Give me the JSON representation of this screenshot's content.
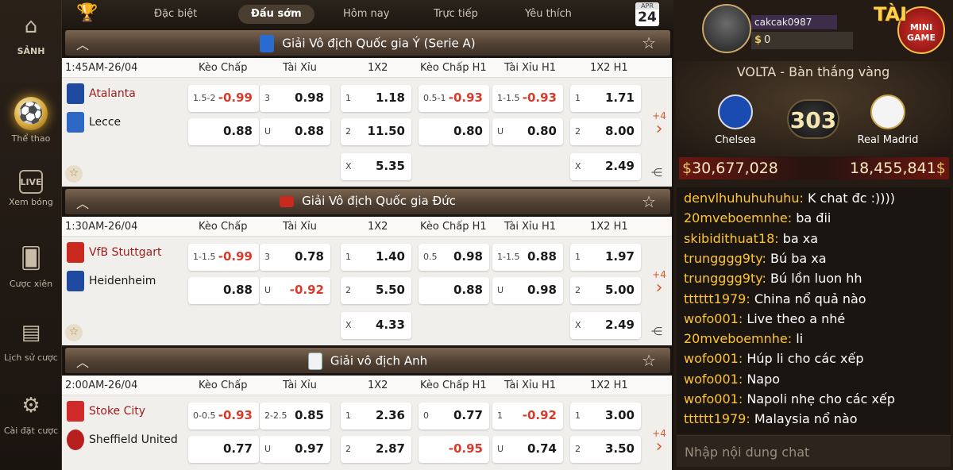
{
  "nav": [
    {
      "label": "SẢNH",
      "icon": "home-icon"
    },
    {
      "label": "Thể thao",
      "icon": "soccer-ball-icon"
    },
    {
      "label": "Xem bóng",
      "icon": "tv-live-icon"
    },
    {
      "label": "Cược xiên",
      "icon": "parlay-icon"
    },
    {
      "label": "Lịch sử cược",
      "icon": "history-icon"
    },
    {
      "label": "Cài đặt cược",
      "icon": "gear-icon"
    }
  ],
  "tabs": [
    "Đặc biệt",
    "Đấu sớm",
    "Hôm nay",
    "Trực tiếp",
    "Yêu thích"
  ],
  "active_tab": "Đấu sớm",
  "date": {
    "month": "APR",
    "day": "24"
  },
  "columns": [
    "Kèo Chấp",
    "Tài Xỉu",
    "1X2",
    "Kèo Chấp H1",
    "Tài Xỉu H1",
    "1X2 H1"
  ],
  "leagues": [
    {
      "name": "Giải Vô địch Quốc gia Ý (Serie A)",
      "time": "1:45AM-26/04",
      "home": "Atalanta",
      "away": "Lecce",
      "more": "+4",
      "row1": [
        [
          "1.5-2",
          "-0.99"
        ],
        [
          "3",
          "0.98"
        ],
        [
          "1",
          "1.18"
        ],
        [
          "0.5-1",
          "-0.93"
        ],
        [
          "1-1.5",
          "-0.93"
        ],
        [
          "1",
          "1.71"
        ]
      ],
      "row2": [
        [
          "",
          "0.88"
        ],
        [
          "U",
          "0.88"
        ],
        [
          "2",
          "11.50"
        ],
        [
          "",
          "0.80"
        ],
        [
          "U",
          "0.80"
        ],
        [
          "2",
          "8.00"
        ]
      ],
      "draw": [
        [
          "X",
          "5.35"
        ],
        [
          "X",
          "2.49"
        ]
      ]
    },
    {
      "name": "Giải Vô địch Quốc gia Đức",
      "time": "1:30AM-26/04",
      "home": "VfB Stuttgart",
      "away": "Heidenheim",
      "more": "+4",
      "row1": [
        [
          "1-1.5",
          "-0.99"
        ],
        [
          "3",
          "0.78"
        ],
        [
          "1",
          "1.40"
        ],
        [
          "0.5",
          "0.98"
        ],
        [
          "1-1.5",
          "0.88"
        ],
        [
          "1",
          "1.97"
        ]
      ],
      "row2": [
        [
          "",
          "0.88"
        ],
        [
          "U",
          "-0.92"
        ],
        [
          "2",
          "5.50"
        ],
        [
          "",
          "0.88"
        ],
        [
          "U",
          "0.98"
        ],
        [
          "2",
          "5.00"
        ]
      ],
      "draw": [
        [
          "X",
          "4.33"
        ],
        [
          "X",
          "2.49"
        ]
      ]
    },
    {
      "name": "Giải vô địch Anh",
      "time": "2:00AM-26/04",
      "home": "Stoke City",
      "away": "Sheffield United",
      "more": "+4",
      "row1": [
        [
          "0-0.5",
          "-0.93"
        ],
        [
          "2-2.5",
          "0.85"
        ],
        [
          "1",
          "2.36"
        ],
        [
          "0",
          "0.77"
        ],
        [
          "1",
          "-0.92"
        ],
        [
          "1",
          "3.00"
        ]
      ],
      "row2": [
        [
          "",
          "0.77"
        ],
        [
          "U",
          "0.97"
        ],
        [
          "2",
          "2.87"
        ],
        [
          "",
          "-0.95"
        ],
        [
          "U",
          "0.74"
        ],
        [
          "2",
          "3.50"
        ]
      ],
      "draw": []
    }
  ],
  "user": {
    "name": "cakcak0987",
    "balance": "0",
    "currency_symbol": "$"
  },
  "minigame": {
    "tai": "TÀI",
    "label": "MINI GAME"
  },
  "volta": {
    "title": "VOLTA - Bàn thắng vàng",
    "home": "Chelsea",
    "away": "Real Madrid",
    "score": "303",
    "home_pot": "30,677,028",
    "away_pot": "18,455,841"
  },
  "chat": [
    {
      "user": "denvlhuhuhuhuhu:",
      "text": " K chat đc :))))"
    },
    {
      "user": "20mveboemnhe:",
      "text": " ba đii"
    },
    {
      "user": "skibidithuat18:",
      "text": " ba xa"
    },
    {
      "user": "trungggg9ty:",
      "text": " Bú ba xa"
    },
    {
      "user": "trungggg9ty:",
      "text": " Bú lồn luon hh"
    },
    {
      "user": "tttttt1979:",
      "text": " China nổ quả nào"
    },
    {
      "user": "wofo001:",
      "text": " Live theo a nhé"
    },
    {
      "user": "20mveboemnhe:",
      "text": " li"
    },
    {
      "user": "wofo001:",
      "text": " Húp li cho các xếp"
    },
    {
      "user": "wofo001:",
      "text": " Napo"
    },
    {
      "user": "wofo001:",
      "text": " Napoli nhẹ cho các xếp"
    },
    {
      "user": "tttttt1979:",
      "text": " Malaysia nổ nào"
    }
  ],
  "chat_placeholder": "Nhập nội dung chat"
}
